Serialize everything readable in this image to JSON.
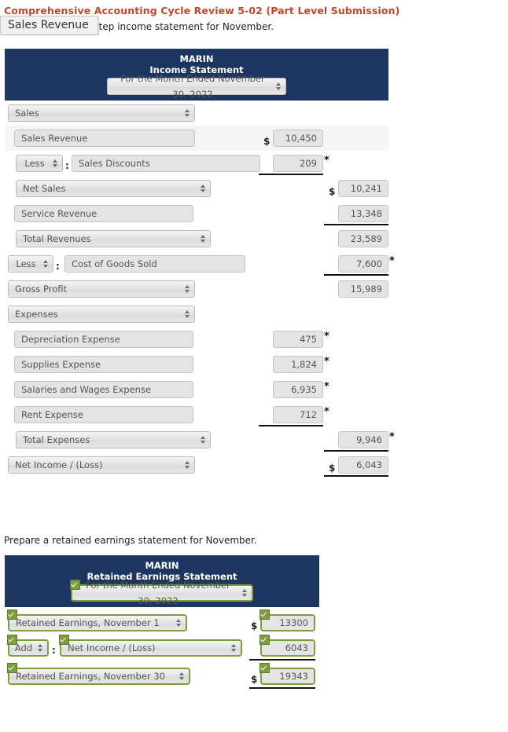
{
  "header": {
    "question_title": "Comprehensive Accounting Cycle Review 5-02 (Part Level Submission)",
    "instruction_income": "Prepare a multiple-step income statement for November.",
    "instruction_retained": "Prepare a retained earnings statement for November.",
    "tooltip": "Sales Revenue"
  },
  "colors": {
    "title_red": "#c0472b",
    "header_navy": "#1d3661",
    "validated_green": "#7d9e3f",
    "control_grey": "#e4e4e4"
  },
  "income_statement": {
    "company": "MARIN",
    "title": "Income Statement",
    "period": "For the Month Ended November 30, 2022",
    "rows": [
      {
        "kind": "select",
        "label": "Sales",
        "col1": "",
        "col2": ""
      },
      {
        "kind": "text",
        "label": "Sales Revenue",
        "col1": "10,450",
        "col2": ""
      },
      {
        "kind": "prefixed",
        "prefix": "Less",
        "label": "Sales Discounts",
        "col1": "209",
        "col2": ""
      },
      {
        "kind": "select",
        "label": "Net Sales",
        "col1": "",
        "col2": "10,241"
      },
      {
        "kind": "text",
        "label": "Service Revenue",
        "col1": "",
        "col2": "13,348"
      },
      {
        "kind": "select",
        "label": "Total Revenues",
        "col1": "",
        "col2": "23,589"
      },
      {
        "kind": "prefixed",
        "prefix": "Less",
        "label": "Cost of Goods Sold",
        "col1": "",
        "col2": "7,600"
      },
      {
        "kind": "select",
        "label": "Gross Profit",
        "col1": "",
        "col2": "15,989"
      },
      {
        "kind": "select",
        "label": "Expenses",
        "col1": "",
        "col2": ""
      },
      {
        "kind": "text",
        "label": "Depreciation Expense",
        "col1": "475",
        "col2": ""
      },
      {
        "kind": "text",
        "label": "Supplies Expense",
        "col1": "1,824",
        "col2": ""
      },
      {
        "kind": "text",
        "label": "Salaries and Wages Expense",
        "col1": "6,935",
        "col2": ""
      },
      {
        "kind": "text",
        "label": "Rent Expense",
        "col1": "712",
        "col2": ""
      },
      {
        "kind": "select",
        "label": "Total Expenses",
        "col1": "",
        "col2": "9,946"
      },
      {
        "kind": "select",
        "label": "Net Income / (Loss)",
        "col1": "",
        "col2": "6,043"
      }
    ]
  },
  "retained_earnings_statement": {
    "company": "MARIN",
    "title": "Retained Earnings Statement",
    "period": "For the Month Ended November 30, 2022",
    "rows": [
      {
        "kind": "select",
        "label": "Retained Earnings, November 1",
        "value": "13300"
      },
      {
        "kind": "prefixed",
        "prefix": "Add",
        "label": "Net Income / (Loss)",
        "value": "6043"
      },
      {
        "kind": "select",
        "label": "Retained Earnings, November 30",
        "value": "19343"
      }
    ]
  },
  "symbols": {
    "dollar": "$",
    "asterisk": "*",
    "colon": ":"
  }
}
